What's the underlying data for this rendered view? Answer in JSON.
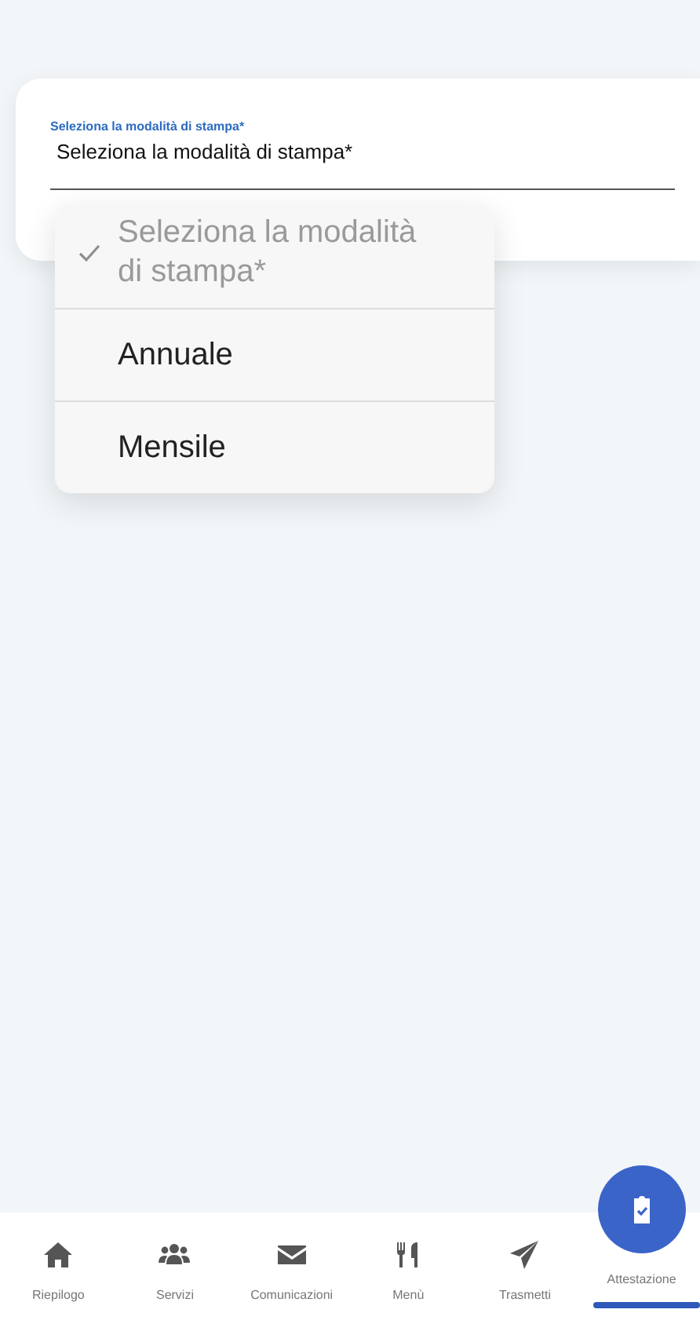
{
  "field": {
    "label": "Seleziona la modalità di stampa*",
    "value": "Seleziona la modalità di stampa*"
  },
  "menu": {
    "options": [
      {
        "label": "Seleziona la modalità di stampa*",
        "selected": true,
        "disabled": true
      },
      {
        "label": "Annuale",
        "selected": false,
        "disabled": false
      },
      {
        "label": "Mensile",
        "selected": false,
        "disabled": false
      }
    ]
  },
  "nav": {
    "tabs": [
      {
        "label": "Riepilogo",
        "selected": false
      },
      {
        "label": "Servizi",
        "selected": false
      },
      {
        "label": "Comunicazioni",
        "selected": false
      },
      {
        "label": "Menù",
        "selected": false
      },
      {
        "label": "Trasmetti",
        "selected": false
      },
      {
        "label": "Attestazione",
        "selected": true
      }
    ]
  }
}
